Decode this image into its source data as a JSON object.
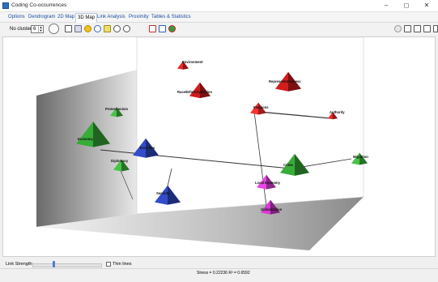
{
  "window": {
    "title": "Coding Co-occurrences",
    "minimize": "–",
    "maximize": "◻",
    "close": "✕"
  },
  "menu": {
    "tabs": [
      {
        "label": "Options"
      },
      {
        "label": "Dendrogram"
      },
      {
        "label": "2D Map"
      },
      {
        "label": "3D Map"
      },
      {
        "label": "Link Analysis"
      },
      {
        "label": "Proximity"
      },
      {
        "label": "Tables & Statistics"
      }
    ],
    "active": "3D Map"
  },
  "toolbar": {
    "clusters_label": "No clusters:",
    "clusters_value": "6"
  },
  "nodes": [
    {
      "label": "Environment",
      "color": "#c62020"
    },
    {
      "label": "Representativeness",
      "color": "#b01818"
    },
    {
      "label": "Race/Ethnicity/Nation",
      "color": "#b01818"
    },
    {
      "label": "Elections",
      "color": "#e02a2a"
    },
    {
      "label": "Authority",
      "color": "#c62020"
    },
    {
      "label": "Protectionism",
      "color": "#3aa33a"
    },
    {
      "label": "Economy",
      "color": "#2f8f2f"
    },
    {
      "label": "Diplomacy",
      "color": "#3aa33a"
    },
    {
      "label": "Terrorism",
      "color": "#2a3fa8"
    },
    {
      "label": "Security",
      "color": "#2a3fa8"
    },
    {
      "label": "Crime",
      "color": "#2f8f2f"
    },
    {
      "label": "Migration",
      "color": "#3aa33a"
    },
    {
      "label": "Local Economy",
      "color": "#c23bbf"
    },
    {
      "label": "Globalization",
      "color": "#b52fb2"
    }
  ],
  "bottom": {
    "link_strength_label": "Link Strength:",
    "link_strength": 0.31,
    "thin_lines_label": "Thin lines",
    "thin_lines_checked": false
  },
  "status": {
    "stress": "Stress = 0.22236   R² = 0.6592"
  }
}
